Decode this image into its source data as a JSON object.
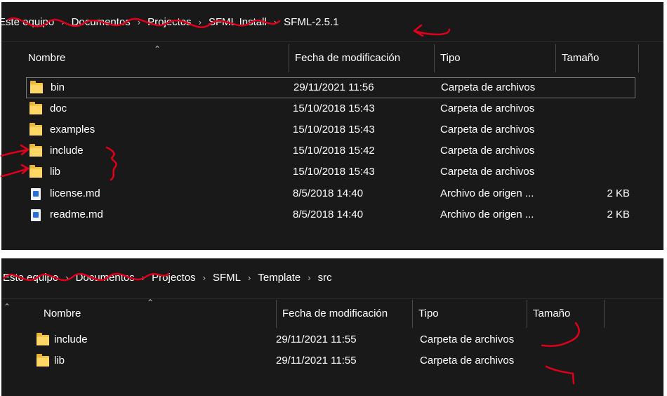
{
  "windows": [
    {
      "breadcrumb": [
        "Este equipo",
        "Documentos",
        "Projectos",
        "SFML Install",
        "SFML-2.5.1"
      ],
      "columns": {
        "name": "Nombre",
        "date": "Fecha de modificación",
        "type": "Tipo",
        "size": "Tamaño"
      },
      "rows": [
        {
          "name": "bin",
          "date": "29/11/2021 11:56",
          "type": "Carpeta de archivos",
          "size": "",
          "icon": "folder-icon",
          "selected": true
        },
        {
          "name": "doc",
          "date": "15/10/2018 15:43",
          "type": "Carpeta de archivos",
          "size": "",
          "icon": "folder-icon"
        },
        {
          "name": "examples",
          "date": "15/10/2018 15:43",
          "type": "Carpeta de archivos",
          "size": "",
          "icon": "folder-icon"
        },
        {
          "name": "include",
          "date": "15/10/2018 15:42",
          "type": "Carpeta de archivos",
          "size": "",
          "icon": "folder-icon"
        },
        {
          "name": "lib",
          "date": "15/10/2018 15:43",
          "type": "Carpeta de archivos",
          "size": "",
          "icon": "folder-icon"
        },
        {
          "name": "license.md",
          "date": "8/5/2018 14:40",
          "type": "Archivo de origen ...",
          "size": "2 KB",
          "icon": "markdown-file-icon"
        },
        {
          "name": "readme.md",
          "date": "8/5/2018 14:40",
          "type": "Archivo de origen ...",
          "size": "2 KB",
          "icon": "markdown-file-icon"
        }
      ]
    },
    {
      "breadcrumb": [
        "Este equipo",
        "Documentos",
        "Projectos",
        "SFML",
        "Template",
        "src"
      ],
      "columns": {
        "name": "Nombre",
        "date": "Fecha de modificación",
        "type": "Tipo",
        "size": "Tamaño"
      },
      "rows": [
        {
          "name": "include",
          "date": "29/11/2021 11:55",
          "type": "Carpeta de archivos",
          "size": "",
          "icon": "folder-icon"
        },
        {
          "name": "lib",
          "date": "29/11/2021 11:55",
          "type": "Carpeta de archivos",
          "size": "",
          "icon": "folder-icon"
        }
      ]
    }
  ],
  "colors": {
    "background": "#191919",
    "text": "#ffffff",
    "folder": "#ffd766",
    "annotation_ink": "#e0001b"
  }
}
